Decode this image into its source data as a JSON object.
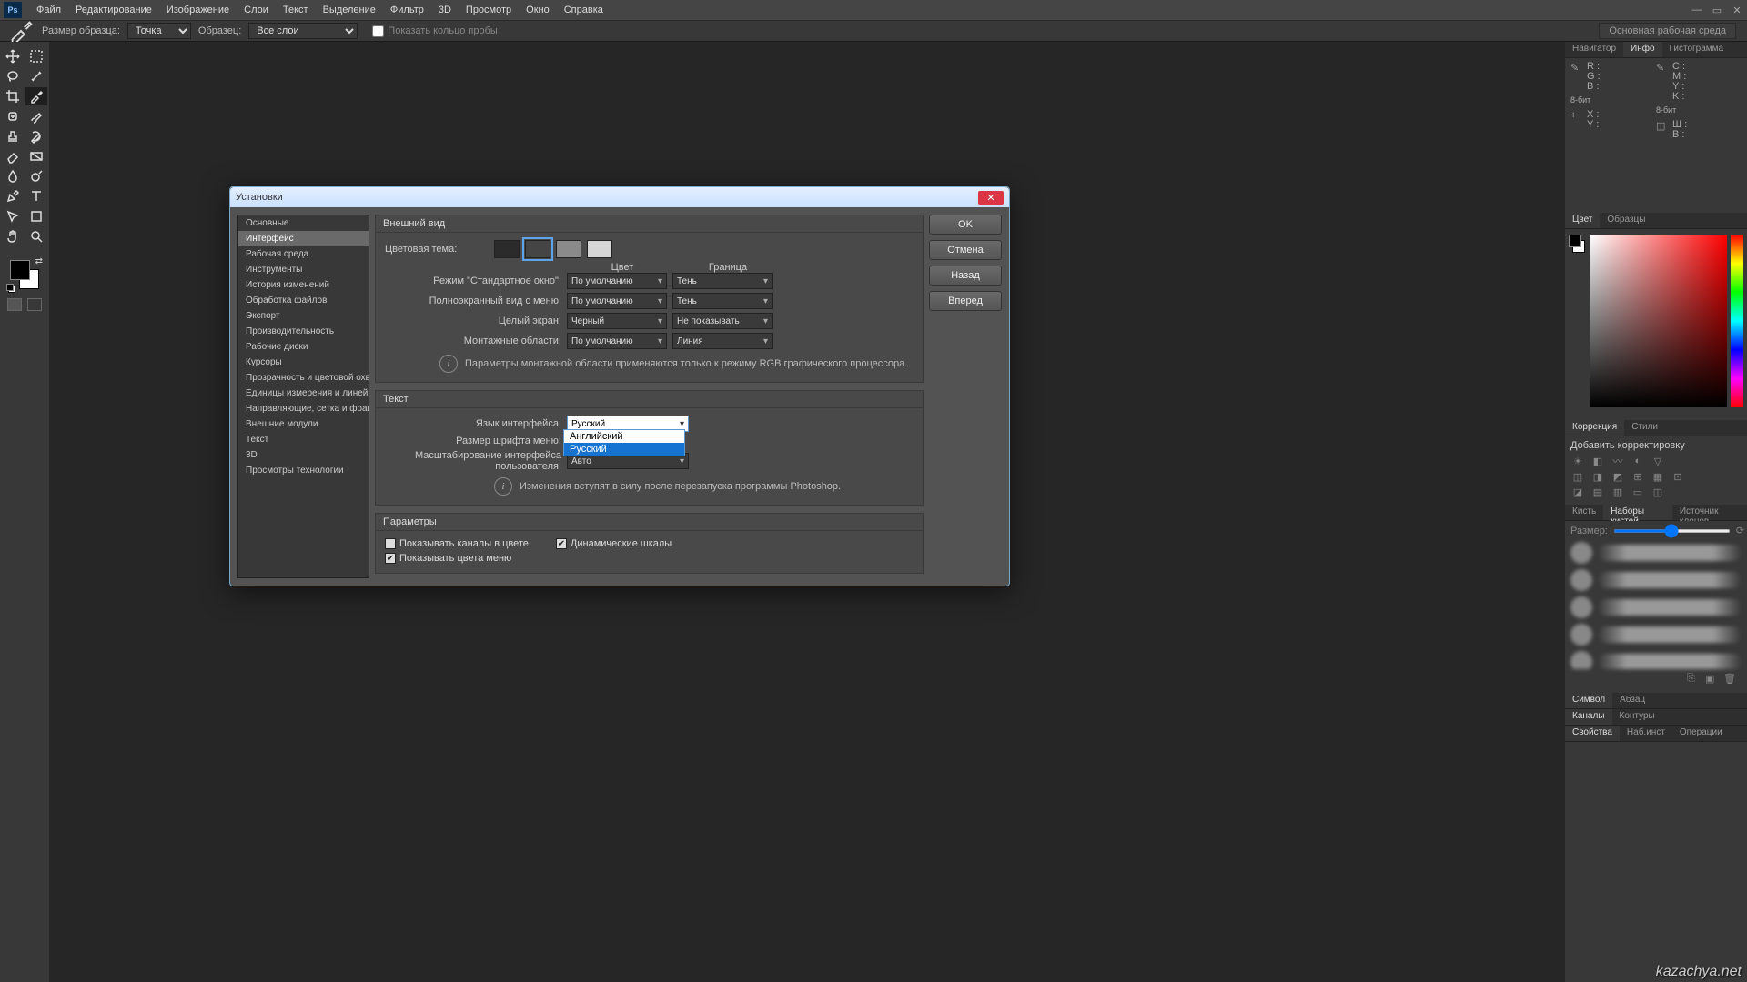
{
  "menubar": {
    "items": [
      "Файл",
      "Редактирование",
      "Изображение",
      "Слои",
      "Текст",
      "Выделение",
      "Фильтр",
      "3D",
      "Просмотр",
      "Окно",
      "Справка"
    ],
    "logo": "Ps"
  },
  "optbar": {
    "sample_label": "Размер образца:",
    "sample_value": "Точка",
    "layers_label": "Образец:",
    "layers_value": "Все слои",
    "ring_label": "Показать кольцо пробы",
    "workspace": "Основная рабочая среда"
  },
  "info_panel": {
    "tabs": [
      "Навигатор",
      "Инфо",
      "Гистограмма"
    ],
    "rgb": [
      "R :",
      "G :",
      "B :"
    ],
    "cmyk": [
      "C :",
      "M :",
      "Y :",
      "K :"
    ],
    "bits": "8-бит",
    "xy": [
      "X :",
      "Y :"
    ],
    "wh": [
      "Ш :",
      "В :"
    ]
  },
  "color_panel": {
    "tabs": [
      "Цвет",
      "Образцы"
    ]
  },
  "adjust_panel": {
    "tabs": [
      "Коррекция",
      "Стили"
    ],
    "title": "Добавить корректировку"
  },
  "brush_panel": {
    "tabs": [
      "Кисть",
      "Наборы кистей",
      "Источник клонов"
    ],
    "size_label": "Размер:"
  },
  "char_panel": {
    "tabs": [
      "Символ",
      "Абзац"
    ]
  },
  "chan_panel": {
    "tabs": [
      "Каналы",
      "Контуры"
    ]
  },
  "prop_panel": {
    "tabs": [
      "Свойства",
      "Наб.инст",
      "Операции"
    ]
  },
  "dialog": {
    "title": "Установки",
    "categories": [
      "Основные",
      "Интерфейс",
      "Рабочая среда",
      "Инструменты",
      "История изменений",
      "Обработка файлов",
      "Экспорт",
      "Производительность",
      "Рабочие диски",
      "Курсоры",
      "Прозрачность и цветовой охват",
      "Единицы измерения и линейки",
      "Направляющие, сетка и фрагменты",
      "Внешние модули",
      "Текст",
      "3D",
      "Просмотры технологии"
    ],
    "selected_category": 1,
    "group_appearance": "Внешний вид",
    "color_theme_label": "Цветовая тема:",
    "themes": [
      "#2b2b2b",
      "#454545",
      "#8a8a8a",
      "#d6d6d6"
    ],
    "theme_selected": 1,
    "col_color": "Цвет",
    "col_border": "Граница",
    "mode_std_label": "Режим \"Стандартное окно\":",
    "mode_std_color": "По умолчанию",
    "mode_std_border": "Тень",
    "mode_fullmenu_label": "Полноэкранный вид с меню:",
    "mode_fullmenu_color": "По умолчанию",
    "mode_fullmenu_border": "Тень",
    "mode_full_label": "Целый экран:",
    "mode_full_color": "Черный",
    "mode_full_border": "Не показывать",
    "artboard_label": "Монтажные области:",
    "artboard_color": "По умолчанию",
    "artboard_border": "Линия",
    "artboard_note": "Параметры монтажной области применяются только к режиму RGB графического процессора.",
    "group_text": "Текст",
    "lang_label": "Язык интерфейса:",
    "lang_value": "Русский",
    "lang_options": [
      "Английский",
      "Русский"
    ],
    "lang_hover": 1,
    "fontsize_label": "Размер шрифта меню:",
    "scale_label": "Масштабирование интерфейса пользователя:",
    "scale_value": "Авто",
    "text_note": "Изменения вступят в силу после перезапуска программы Photoshop.",
    "group_params": "Параметры",
    "chk_channels": "Показывать каналы в цвете",
    "chk_channels_on": false,
    "chk_scales": "Динамические шкалы",
    "chk_scales_on": true,
    "chk_menucolors": "Показывать цвета меню",
    "chk_menucolors_on": true,
    "buttons": {
      "ok": "OK",
      "cancel": "Отмена",
      "prev": "Назад",
      "next": "Вперед"
    }
  },
  "watermark": "kazachya.net"
}
